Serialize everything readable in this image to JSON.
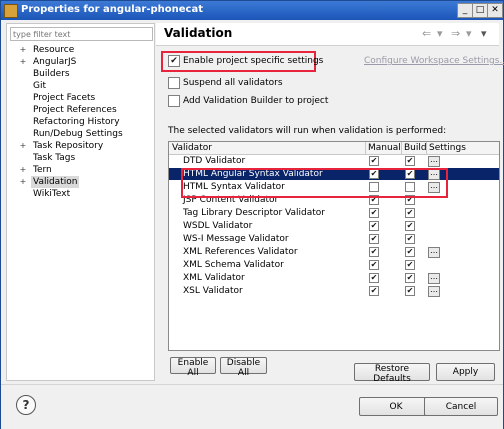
{
  "window": {
    "title": "Properties for angular-phonecat"
  },
  "left": {
    "filter_placeholder": "type filter text",
    "tree": [
      {
        "label": "Resource",
        "twisty": "+"
      },
      {
        "label": "AngularJS",
        "twisty": "+"
      },
      {
        "label": "Builders",
        "twisty": ""
      },
      {
        "label": "Git",
        "twisty": ""
      },
      {
        "label": "Project Facets",
        "twisty": ""
      },
      {
        "label": "Project References",
        "twisty": ""
      },
      {
        "label": "Refactoring History",
        "twisty": ""
      },
      {
        "label": "Run/Debug Settings",
        "twisty": ""
      },
      {
        "label": "Task Repository",
        "twisty": "+"
      },
      {
        "label": "Task Tags",
        "twisty": ""
      },
      {
        "label": "Tern",
        "twisty": "+"
      },
      {
        "label": "Validation",
        "twisty": "+",
        "selected": true
      },
      {
        "label": "WikiText",
        "twisty": ""
      }
    ]
  },
  "page": {
    "title": "Validation",
    "enable_label": "Enable project specific settings",
    "configure_link": "Configure Workspace Settings...",
    "suspend_label": "Suspend all validators",
    "add_builder_label": "Add Validation Builder to project",
    "info_text": "The selected validators will run when validation is performed:",
    "columns": [
      "Validator",
      "Manual",
      "Build",
      "Settings"
    ],
    "validators": [
      {
        "name": "DTD Validator",
        "manual": true,
        "build": true,
        "settings": true
      },
      {
        "name": "HTML Angular Syntax Validator",
        "manual": true,
        "build": true,
        "settings": true,
        "selected": true
      },
      {
        "name": "HTML Syntax Validator",
        "manual": false,
        "build": false,
        "settings": true
      },
      {
        "name": "JSP Content Validator",
        "manual": true,
        "build": true,
        "settings": false
      },
      {
        "name": "Tag Library Descriptor Validator",
        "manual": true,
        "build": true,
        "settings": false
      },
      {
        "name": "WSDL Validator",
        "manual": true,
        "build": true,
        "settings": false
      },
      {
        "name": "WS-I Message Validator",
        "manual": true,
        "build": true,
        "settings": false
      },
      {
        "name": "XML References Validator",
        "manual": true,
        "build": true,
        "settings": true
      },
      {
        "name": "XML Schema Validator",
        "manual": true,
        "build": true,
        "settings": false
      },
      {
        "name": "XML Validator",
        "manual": true,
        "build": true,
        "settings": true
      },
      {
        "name": "XSL Validator",
        "manual": true,
        "build": true,
        "settings": true
      }
    ],
    "enable_all": "Enable All",
    "disable_all": "Disable All",
    "restore_defaults": "Restore Defaults",
    "apply": "Apply"
  },
  "footer": {
    "ok": "OK",
    "cancel": "Cancel"
  },
  "colors": {
    "highlight_box": "#e8243c",
    "selection": "#0a246a"
  }
}
